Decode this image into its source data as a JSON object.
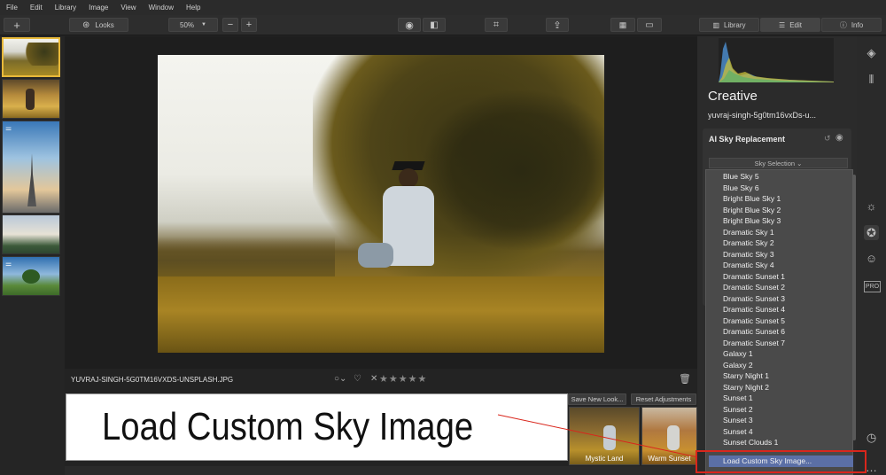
{
  "menubar": [
    "File",
    "Edit",
    "Library",
    "Image",
    "View",
    "Window",
    "Help"
  ],
  "toolbar": {
    "add_label": "+",
    "looks_label": "Looks",
    "zoom_value": "50%",
    "zoom_minus": "−",
    "zoom_plus": "+",
    "tabs": [
      "Library",
      "Edit",
      "Info"
    ]
  },
  "photo_filename": "YUVRAJ-SINGH-5G0TM16VXDS-UNSPLASH.JPG",
  "rating_stars": "★★★★★",
  "looks": {
    "save_new_look": "Save New Look...",
    "reset_adjustments": "Reset Adjustments",
    "thumbs": [
      "Mystic Land",
      "Warm Sunset"
    ]
  },
  "callout": "Load Custom Sky Image",
  "panel": {
    "section_title": "Creative",
    "file_name": "yuvraj-singh-5g0tm16vxDs-u...",
    "tool_title": "AI Sky Replacement",
    "sky_selection": "Sky Selection ⌄"
  },
  "sky_options": [
    "Blue Sky 5",
    "Blue Sky 6",
    "Bright Blue Sky 1",
    "Bright Blue Sky 2",
    "Bright Blue Sky 3",
    "Dramatic Sky 1",
    "Dramatic Sky 2",
    "Dramatic Sky 3",
    "Dramatic Sky 4",
    "Dramatic Sunset 1",
    "Dramatic Sunset 2",
    "Dramatic Sunset 3",
    "Dramatic Sunset 4",
    "Dramatic Sunset 5",
    "Dramatic Sunset 6",
    "Dramatic Sunset 7",
    "Galaxy 1",
    "Galaxy 2",
    "Starry Night 1",
    "Starry Night 2",
    "Sunset 1",
    "Sunset 2",
    "Sunset 3",
    "Sunset 4",
    "Sunset Clouds 1",
    "Load Custom Sky Image..."
  ],
  "side_icons": [
    "layers-icon",
    "compare-icon",
    "sun-icon",
    "palette-icon",
    "smile-icon",
    "pro-badge",
    "clock-icon",
    "more-icon"
  ],
  "pro_label": "PRO",
  "colors": {
    "accent_yellow": "#e8b93a",
    "highlight": "#5b6fa6",
    "annotation_red": "#d9261c"
  }
}
